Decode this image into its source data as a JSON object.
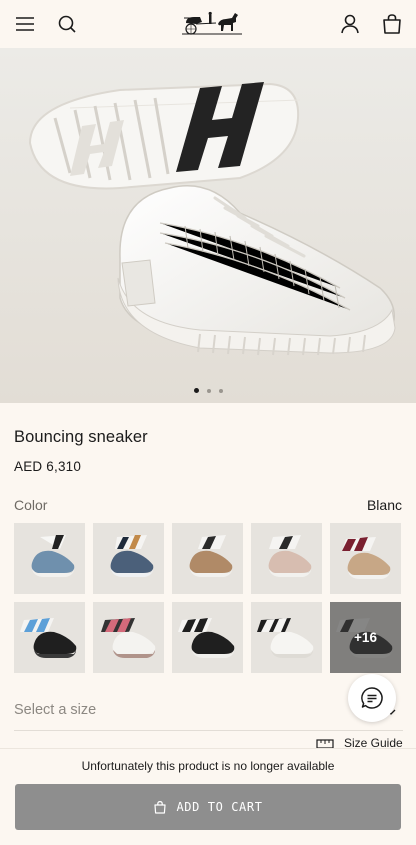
{
  "header": {
    "menu_icon": "hamburger-menu-icon",
    "search_icon": "search-icon",
    "logo_icon": "horse-carriage-logo",
    "account_icon": "person-icon",
    "bag_icon": "shopping-bag-icon"
  },
  "gallery": {
    "dots": [
      {
        "active": true
      },
      {
        "active": false
      },
      {
        "active": false
      }
    ]
  },
  "product": {
    "title": "Bouncing sneaker",
    "price": "AED 6,310"
  },
  "color": {
    "label": "Color",
    "selected": "Blanc",
    "swatches": [
      {
        "icon": "sneaker-blue"
      },
      {
        "icon": "sneaker-navy"
      },
      {
        "icon": "sneaker-camel"
      },
      {
        "icon": "sneaker-pink"
      },
      {
        "icon": "sneaker-beige-red"
      },
      {
        "icon": "sneaker-black-blue"
      },
      {
        "icon": "sneaker-white-pink"
      },
      {
        "icon": "sneaker-black-white"
      },
      {
        "icon": "sneaker-white-black"
      },
      {
        "icon": "sneaker-black",
        "more": "+16"
      }
    ]
  },
  "size": {
    "placeholder": "Select a size",
    "guide_label": "Size Guide"
  },
  "chat": {
    "icon": "chat-bubble-icon"
  },
  "footer": {
    "unavailable_text": "Unfortunately this product is no longer available",
    "add_to_cart": "ADD TO CART",
    "cart_icon": "shopping-bag-icon"
  },
  "colors": {
    "background": "#fcf7f1",
    "button_disabled": "#8e8e8e",
    "text": "#1b1b1b"
  }
}
